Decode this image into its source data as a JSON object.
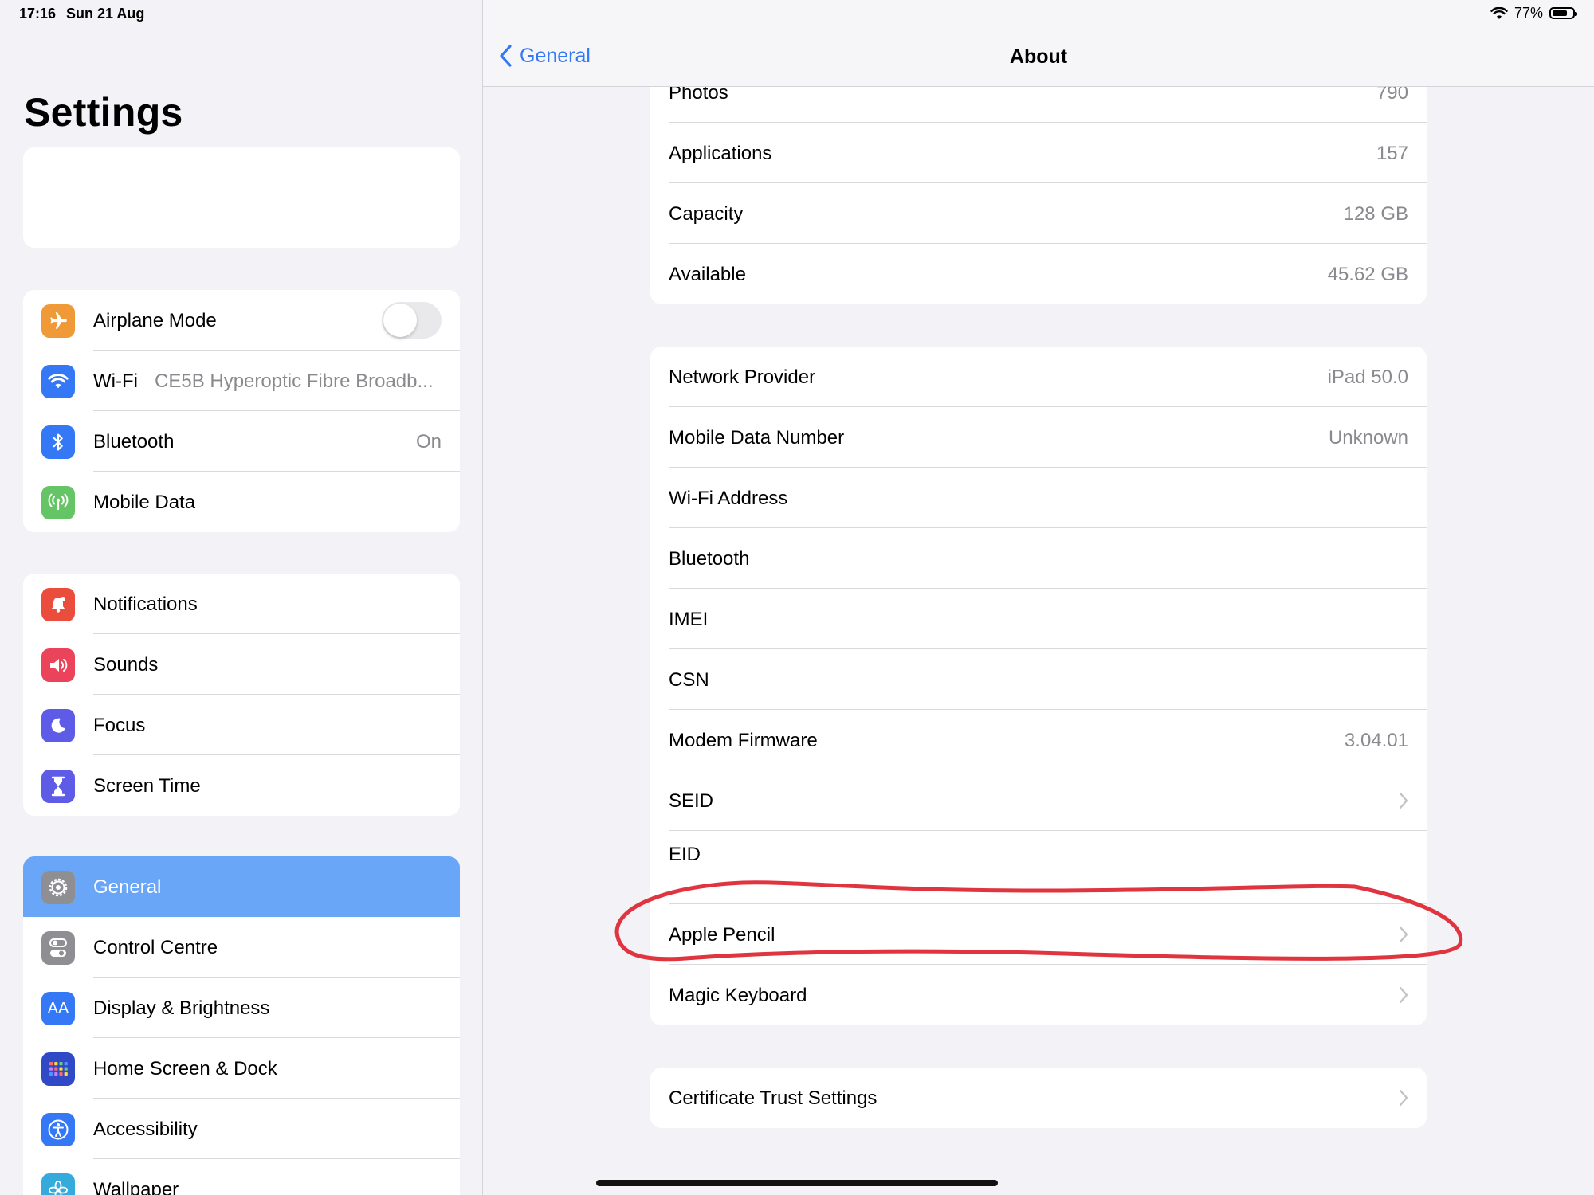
{
  "status": {
    "time": "17:16",
    "date": "Sun 21 Aug",
    "battery_label": "77%",
    "battery_level": 0.77
  },
  "sidebar": {
    "title": "Settings",
    "group1": [
      {
        "label": "Airplane Mode",
        "icon": "airplane-icon",
        "color": "#f09a37",
        "toggle": false
      },
      {
        "label": "Wi-Fi",
        "value": "CE5B Hyperoptic Fibre Broadb...",
        "icon": "wifi-icon",
        "color": "#3478f6"
      },
      {
        "label": "Bluetooth",
        "value": "On",
        "icon": "bluetooth-icon",
        "color": "#3478f6"
      },
      {
        "label": "Mobile Data",
        "icon": "antenna-icon",
        "color": "#65c466"
      }
    ],
    "group2": [
      {
        "label": "Notifications",
        "icon": "bell-icon",
        "color": "#eb4d3d"
      },
      {
        "label": "Sounds",
        "icon": "speaker-icon",
        "color": "#eb445a"
      },
      {
        "label": "Focus",
        "icon": "moon-icon",
        "color": "#5e5ce6"
      },
      {
        "label": "Screen Time",
        "icon": "hourglass-icon",
        "color": "#5e5ce6"
      }
    ],
    "group3": [
      {
        "label": "General",
        "icon": "gear-icon",
        "color": "#8e8e93",
        "selected": true
      },
      {
        "label": "Control Centre",
        "icon": "switches-icon",
        "color": "#8e8e93"
      },
      {
        "label": "Display & Brightness",
        "icon": "text-size-icon",
        "color": "#3478f6",
        "glyph": "AA"
      },
      {
        "label": "Home Screen & Dock",
        "icon": "grid-icon",
        "color": "#2f49c7"
      },
      {
        "label": "Accessibility",
        "icon": "accessibility-icon",
        "color": "#3478f6"
      },
      {
        "label": "Wallpaper",
        "icon": "flower-icon",
        "color": "#35aadc"
      }
    ]
  },
  "detail": {
    "back_label": "General",
    "title": "About",
    "group1": [
      {
        "label": "Photos",
        "value": "790"
      },
      {
        "label": "Applications",
        "value": "157"
      },
      {
        "label": "Capacity",
        "value": "128 GB"
      },
      {
        "label": "Available",
        "value": "45.62 GB"
      }
    ],
    "group2": [
      {
        "label": "Network Provider",
        "value": "iPad 50.0"
      },
      {
        "label": "Mobile Data Number",
        "value": "Unknown"
      },
      {
        "label": "Wi-Fi Address",
        "value": ""
      },
      {
        "label": "Bluetooth",
        "value": ""
      },
      {
        "label": "IMEI",
        "value": ""
      },
      {
        "label": "CSN",
        "value": ""
      },
      {
        "label": "Modem Firmware",
        "value": "3.04.01"
      },
      {
        "label": "SEID",
        "chevron": true
      },
      {
        "label": "EID",
        "value": ""
      },
      {
        "label": "Apple Pencil",
        "chevron": true
      },
      {
        "label": "Magic Keyboard",
        "chevron": true
      }
    ],
    "group3": [
      {
        "label": "Certificate Trust Settings",
        "chevron": true
      }
    ]
  },
  "annotation_color": "#e0343f"
}
